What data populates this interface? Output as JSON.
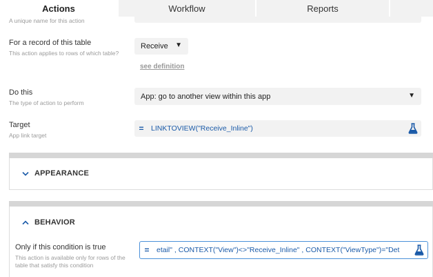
{
  "tabs": [
    {
      "label": "Actions",
      "active": true
    },
    {
      "label": "Workflow",
      "active": false
    },
    {
      "label": "Reports",
      "active": false
    }
  ],
  "name_field": {
    "hint": "A unique name for this action"
  },
  "record_table": {
    "label": "For a record of this table",
    "hint": "This action applies to rows of which table?",
    "value": "Receive",
    "link": "see definition"
  },
  "do_this": {
    "label": "Do this",
    "hint": "The type of action to perform",
    "value": "App: go to another view within this app"
  },
  "target": {
    "label": "Target",
    "hint": "App link target",
    "eq": "=",
    "expression": "LINKTOVIEW(\"Receive_Inline\")"
  },
  "appearance": {
    "title": "APPEARANCE"
  },
  "behavior": {
    "title": "BEHAVIOR",
    "condition_label": "Only if this condition is true",
    "condition_hint": "This action is available only for rows of the table that satisfy this condition",
    "eq": "=",
    "expression": "etail\"   ,  CONTEXT(\"View\")<>\"Receive_Inline\"   ,  CONTEXT(\"ViewType\")=\"Det"
  },
  "colors": {
    "accent": "#1a5aa8",
    "focus_border": "#4a90d9",
    "field_bg": "#f2f2f2"
  },
  "icons": {
    "select_arrow": "caret-down-icon",
    "flask": "flask-icon",
    "collapse": "chevron-down-icon",
    "expand": "chevron-up-icon"
  }
}
